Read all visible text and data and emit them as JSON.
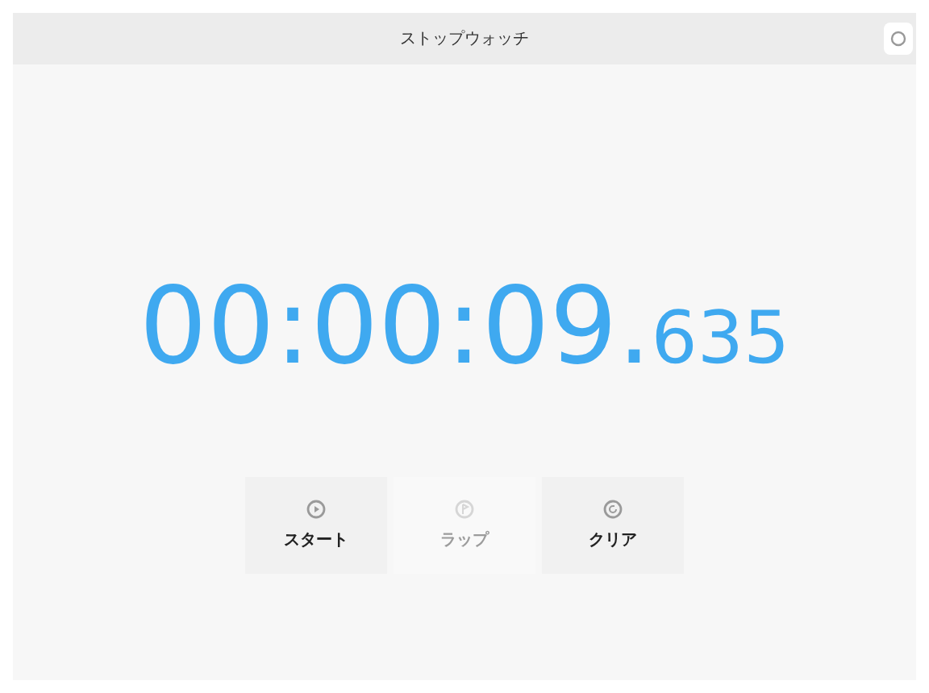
{
  "window": {
    "title": "ストップウォッチ"
  },
  "time": {
    "main": "00:00:09.",
    "fraction": "635"
  },
  "buttons": [
    {
      "label": "スタート",
      "kind": "start",
      "disabled": false
    },
    {
      "label": "ラップ",
      "kind": "lap",
      "disabled": true
    },
    {
      "label": "クリア",
      "kind": "clear",
      "disabled": false
    }
  ]
}
